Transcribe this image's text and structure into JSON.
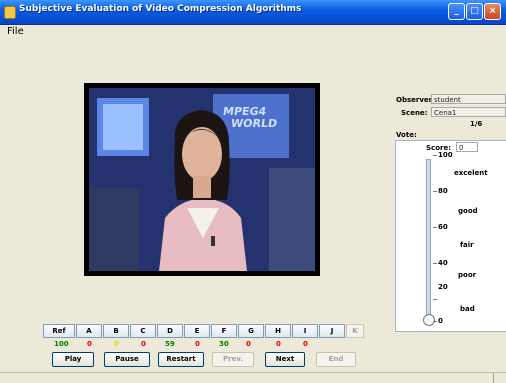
{
  "window": {
    "title": "Subjective Evaluation of Video Compression Algorithms"
  },
  "menu": {
    "file": "File"
  },
  "video": {
    "monitor_text_1": "MPEG4",
    "monitor_text_2": "WORLD"
  },
  "form": {
    "observer_label": "Observer:",
    "observer_value": "student",
    "scene_label": "Scene:",
    "scene_value": "Cena1",
    "counter": "1/6",
    "vote_label": "Vote:",
    "score_label": "Score:",
    "score_value": "0"
  },
  "slider": {
    "value": 0,
    "ticks": [
      "100",
      "80",
      "60",
      "40",
      "20",
      "0"
    ],
    "categories": [
      "excelent",
      "good",
      "fair",
      "poor",
      "bad"
    ]
  },
  "sequence_buttons": [
    {
      "label": "Ref",
      "enabled": true
    },
    {
      "label": "A",
      "enabled": true
    },
    {
      "label": "B",
      "enabled": true
    },
    {
      "label": "C",
      "enabled": true
    },
    {
      "label": "D",
      "enabled": true
    },
    {
      "label": "E",
      "enabled": true
    },
    {
      "label": "F",
      "enabled": true
    },
    {
      "label": "G",
      "enabled": true
    },
    {
      "label": "H",
      "enabled": true
    },
    {
      "label": "I",
      "enabled": true
    },
    {
      "label": "J",
      "enabled": true
    },
    {
      "label": "K",
      "enabled": false
    }
  ],
  "scores": [
    {
      "value": "100",
      "color": "#008000"
    },
    {
      "value": "0",
      "color": "#e00000"
    },
    {
      "value": "0",
      "color": "#e6d800"
    },
    {
      "value": "0",
      "color": "#e00000"
    },
    {
      "value": "59",
      "color": "#008000"
    },
    {
      "value": "0",
      "color": "#e00000"
    },
    {
      "value": "30",
      "color": "#008000"
    },
    {
      "value": "0",
      "color": "#e00000"
    },
    {
      "value": "0",
      "color": "#e00000"
    },
    {
      "value": "0",
      "color": "#e00000"
    }
  ],
  "controls": {
    "play": "Play",
    "pause": "Pause",
    "restart": "Restart",
    "prev": "Prev.",
    "next": "Next",
    "end": "End"
  }
}
